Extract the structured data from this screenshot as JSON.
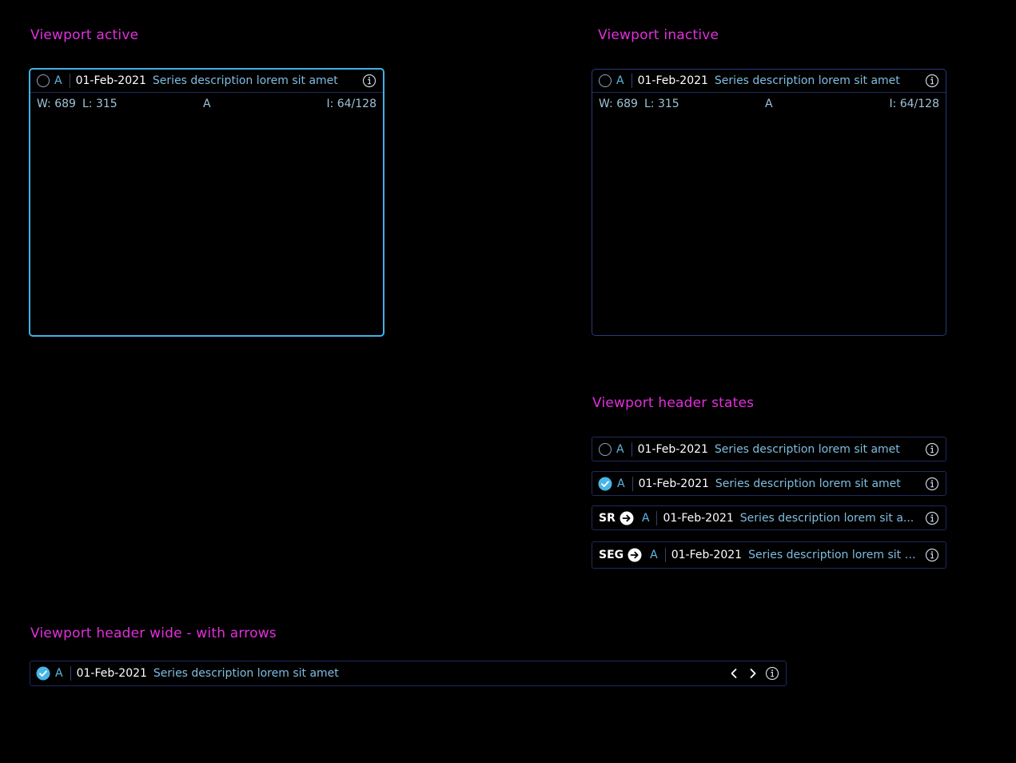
{
  "sections": {
    "active_title": "Viewport active",
    "inactive_title": "Viewport inactive",
    "states_title": "Viewport header states",
    "wide_title": "Viewport header wide - with arrows"
  },
  "viewport": {
    "letter": "A",
    "date": "01-Feb-2021",
    "description": "Series description lorem sit amet",
    "overlay": {
      "window": "W: 689",
      "level": "L: 315",
      "orientation": "A",
      "instance": "I: 64/128"
    }
  },
  "states": [
    {
      "kind": "unchecked",
      "letter": "A",
      "date": "01-Feb-2021",
      "description": "Series description lorem sit amet"
    },
    {
      "kind": "checked",
      "letter": "A",
      "date": "01-Feb-2021",
      "description": "Series description lorem sit amet"
    },
    {
      "kind": "tag",
      "tag": "SR",
      "letter": "A",
      "date": "01-Feb-2021",
      "description": "Series description lorem sit a..."
    },
    {
      "kind": "tag",
      "tag": "SEG",
      "letter": "A",
      "date": "01-Feb-2021",
      "description": "Series description lorem sit a..."
    }
  ],
  "wide": {
    "letter": "A",
    "date": "01-Feb-2021",
    "description": "Series description lorem sit amet"
  },
  "icons": {
    "info": "info-icon",
    "check": "check-circle-icon",
    "arrow": "arrow-right-circle-icon",
    "chevron_left": "chevron-left-icon",
    "chevron_right": "chevron-right-icon"
  },
  "colors": {
    "accent_title": "#e22fdc",
    "active_border": "#3fb2e8",
    "inactive_border": "#2a3a7a",
    "description": "#7fbde0",
    "check": "#47b6e6"
  }
}
